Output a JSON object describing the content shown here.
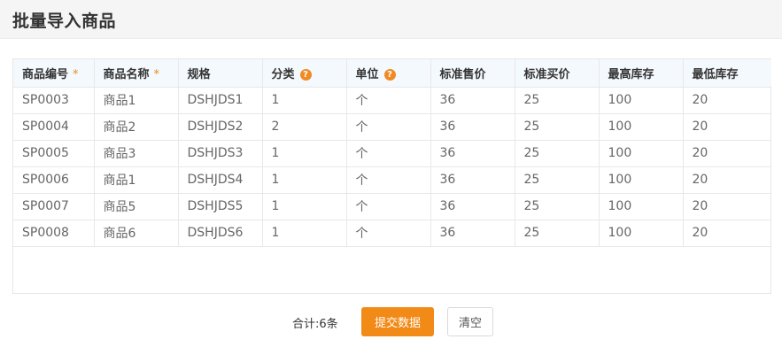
{
  "page_title": "批量导入商品",
  "required_mark": "*",
  "help_icon_glyph": "?",
  "accent_color": "#f28a17",
  "columns": [
    {
      "label": "商品编号",
      "required": true,
      "help": false
    },
    {
      "label": "商品名称",
      "required": true,
      "help": false
    },
    {
      "label": "规格",
      "required": false,
      "help": false
    },
    {
      "label": "分类",
      "required": false,
      "help": true
    },
    {
      "label": "单位",
      "required": false,
      "help": true
    },
    {
      "label": "标准售价",
      "required": false,
      "help": false
    },
    {
      "label": "标准买价",
      "required": false,
      "help": false
    },
    {
      "label": "最高库存",
      "required": false,
      "help": false
    },
    {
      "label": "最低库存",
      "required": false,
      "help": false
    }
  ],
  "rows": [
    [
      "SP0003",
      "商品1",
      "DSHJDS1",
      "1",
      "个",
      "36",
      "25",
      "100",
      "20"
    ],
    [
      "SP0004",
      "商品2",
      "DSHJDS2",
      "2",
      "个",
      "36",
      "25",
      "100",
      "20"
    ],
    [
      "SP0005",
      "商品3",
      "DSHJDS3",
      "1",
      "个",
      "36",
      "25",
      "100",
      "20"
    ],
    [
      "SP0006",
      "商品1",
      "DSHJDS4",
      "1",
      "个",
      "36",
      "25",
      "100",
      "20"
    ],
    [
      "SP0007",
      "商品5",
      "DSHJDS5",
      "1",
      "个",
      "36",
      "25",
      "100",
      "20"
    ],
    [
      "SP0008",
      "商品6",
      "DSHJDS6",
      "1",
      "个",
      "36",
      "25",
      "100",
      "20"
    ]
  ],
  "footer": {
    "total_label": "合计:6条",
    "submit_label": "提交数据",
    "clear_label": "清空"
  }
}
